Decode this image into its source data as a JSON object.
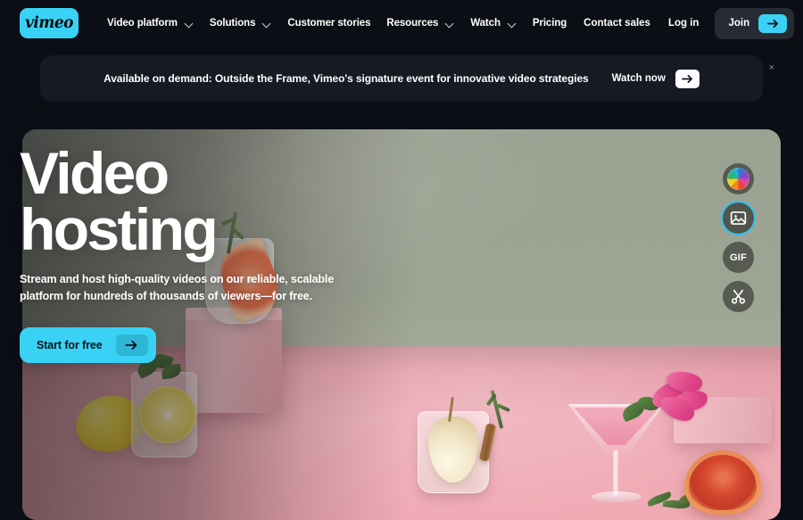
{
  "brand": {
    "logo_text": "vimeo",
    "accent_color": "#39d2f5",
    "page_background": "#0b0e14"
  },
  "header": {
    "nav_items": [
      {
        "label": "Video platform",
        "has_dropdown": true
      },
      {
        "label": "Solutions",
        "has_dropdown": true
      },
      {
        "label": "Customer stories",
        "has_dropdown": false
      },
      {
        "label": "Resources",
        "has_dropdown": true
      },
      {
        "label": "Watch",
        "has_dropdown": true
      },
      {
        "label": "Pricing",
        "has_dropdown": false
      }
    ],
    "contact_sales": "Contact sales",
    "log_in": "Log in",
    "join": "Join"
  },
  "banner": {
    "message": "Available on demand: Outside the Frame, Vimeo's signature event for innovative video strategies",
    "cta_label": "Watch now",
    "close_label": "×"
  },
  "hero": {
    "title_line1": "Video",
    "title_line2": "hosting",
    "subtitle": "Stream and host high-quality videos on our reliable, scalable platform for hundreds of thousands of viewers—for free.",
    "cta_label": "Start for free",
    "tools": [
      {
        "name": "color-wheel",
        "label": "",
        "selected": false
      },
      {
        "name": "image",
        "label": "",
        "selected": true
      },
      {
        "name": "gif",
        "label": "GIF",
        "selected": false
      },
      {
        "name": "scissors",
        "label": "",
        "selected": false
      }
    ]
  }
}
